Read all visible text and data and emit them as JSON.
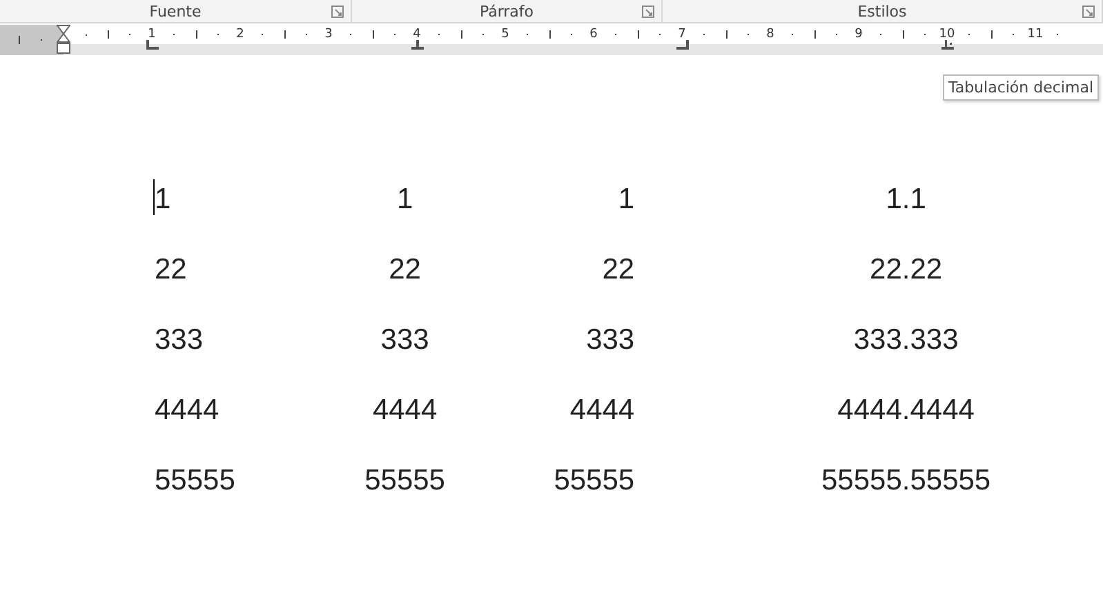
{
  "ribbon_groups": [
    {
      "label": "Fuente"
    },
    {
      "label": "Párrafo"
    },
    {
      "label": "Estilos"
    }
  ],
  "ruler": {
    "numbers": [
      "1",
      "2",
      "3",
      "4",
      "5",
      "6",
      "7",
      "8",
      "9",
      "10",
      "11"
    ],
    "tab_stops": [
      {
        "kind": "left"
      },
      {
        "kind": "center"
      },
      {
        "kind": "right"
      },
      {
        "kind": "decimal"
      }
    ]
  },
  "tooltip": "Tabulación decimal",
  "rows": [
    [
      "1",
      "1",
      "1",
      "1.1"
    ],
    [
      "22",
      "22",
      "22",
      "22.22"
    ],
    [
      "333",
      "333",
      "333",
      "333.333"
    ],
    [
      "4444",
      "4444",
      "4444",
      "4444.4444"
    ],
    [
      "55555",
      "55555",
      "55555",
      "55555.55555"
    ]
  ]
}
